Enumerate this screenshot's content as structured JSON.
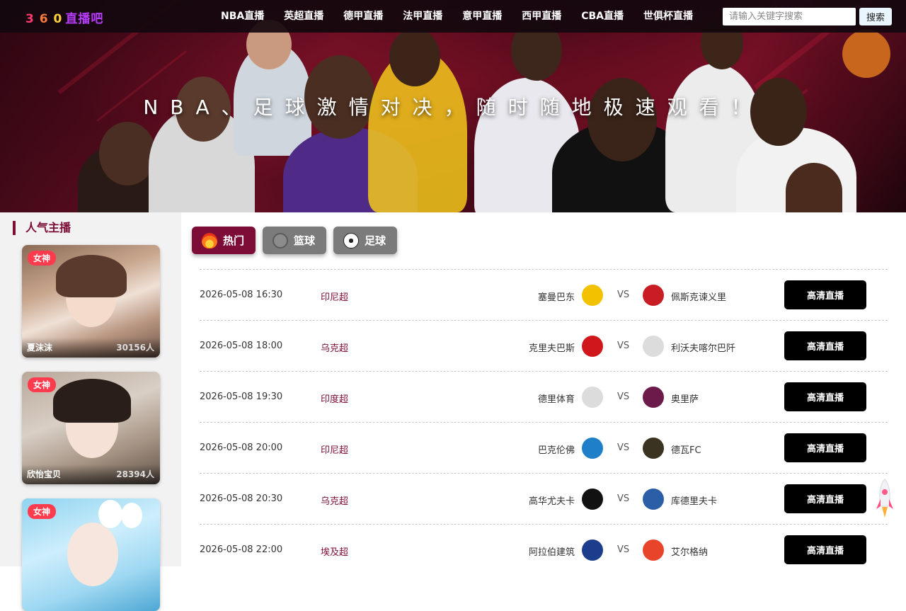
{
  "brand": {
    "num1": "3",
    "num2": "6",
    "num3": "0",
    "name": "直播吧"
  },
  "nav": [
    {
      "label": "NBA直播"
    },
    {
      "label": "英超直播"
    },
    {
      "label": "德甲直播"
    },
    {
      "label": "法甲直播"
    },
    {
      "label": "意甲直播"
    },
    {
      "label": "西甲直播"
    },
    {
      "label": "CBA直播"
    },
    {
      "label": "世俱杯直播"
    }
  ],
  "search": {
    "placeholder": "请输入关键字搜索",
    "value": "",
    "button": "搜索"
  },
  "banner": {
    "slogan": "NBA、足球激情对决，随时随地极速观看！"
  },
  "sidebar": {
    "title": "人气主播",
    "anchors": [
      {
        "tag": "女神",
        "name": "夏沫沫",
        "count": "30156人"
      },
      {
        "tag": "女神",
        "name": "欣怡宝贝",
        "count": "28394人"
      },
      {
        "tag": "女神",
        "name": "",
        "count": ""
      }
    ]
  },
  "tabs": [
    {
      "label": "热门",
      "icon": "fire-icon"
    },
    {
      "label": "篮球",
      "icon": "basketball-icon"
    },
    {
      "label": "足球",
      "icon": "soccer-ball-icon"
    }
  ],
  "matches": [
    {
      "time": "2026-05-08 16:30",
      "league": "印尼超",
      "home": "塞曼巴东",
      "away": "佩斯克谏义里",
      "vs": "VS",
      "button": "高清直播",
      "home_color": "#f2c200",
      "away_color": "#c81d25"
    },
    {
      "time": "2026-05-08 18:00",
      "league": "乌克超",
      "home": "克里夫巴斯",
      "away": "利沃夫喀尔巴阡",
      "vs": "VS",
      "button": "高清直播",
      "home_color": "#d0181c",
      "away_color": "#dcdcdc"
    },
    {
      "time": "2026-05-08 19:30",
      "league": "印度超",
      "home": "德里体育",
      "away": "奥里萨",
      "vs": "VS",
      "button": "高清直播",
      "home_color": "#dcdcdc",
      "away_color": "#6b1a4a"
    },
    {
      "time": "2026-05-08 20:00",
      "league": "印尼超",
      "home": "巴克伦佛",
      "away": "德瓦FC",
      "vs": "VS",
      "button": "高清直播",
      "home_color": "#1f7fc8",
      "away_color": "#3a3322"
    },
    {
      "time": "2026-05-08 20:30",
      "league": "乌克超",
      "home": "高华尤夫卡",
      "away": "库德里夫卡",
      "vs": "VS",
      "button": "高清直播",
      "home_color": "#111111",
      "away_color": "#2a5fa8"
    },
    {
      "time": "2026-05-08 22:00",
      "league": "埃及超",
      "home": "阿拉伯建筑",
      "away": "艾尔格纳",
      "vs": "VS",
      "button": "高清直播",
      "home_color": "#1c3c8c",
      "away_color": "#e8442a"
    }
  ]
}
